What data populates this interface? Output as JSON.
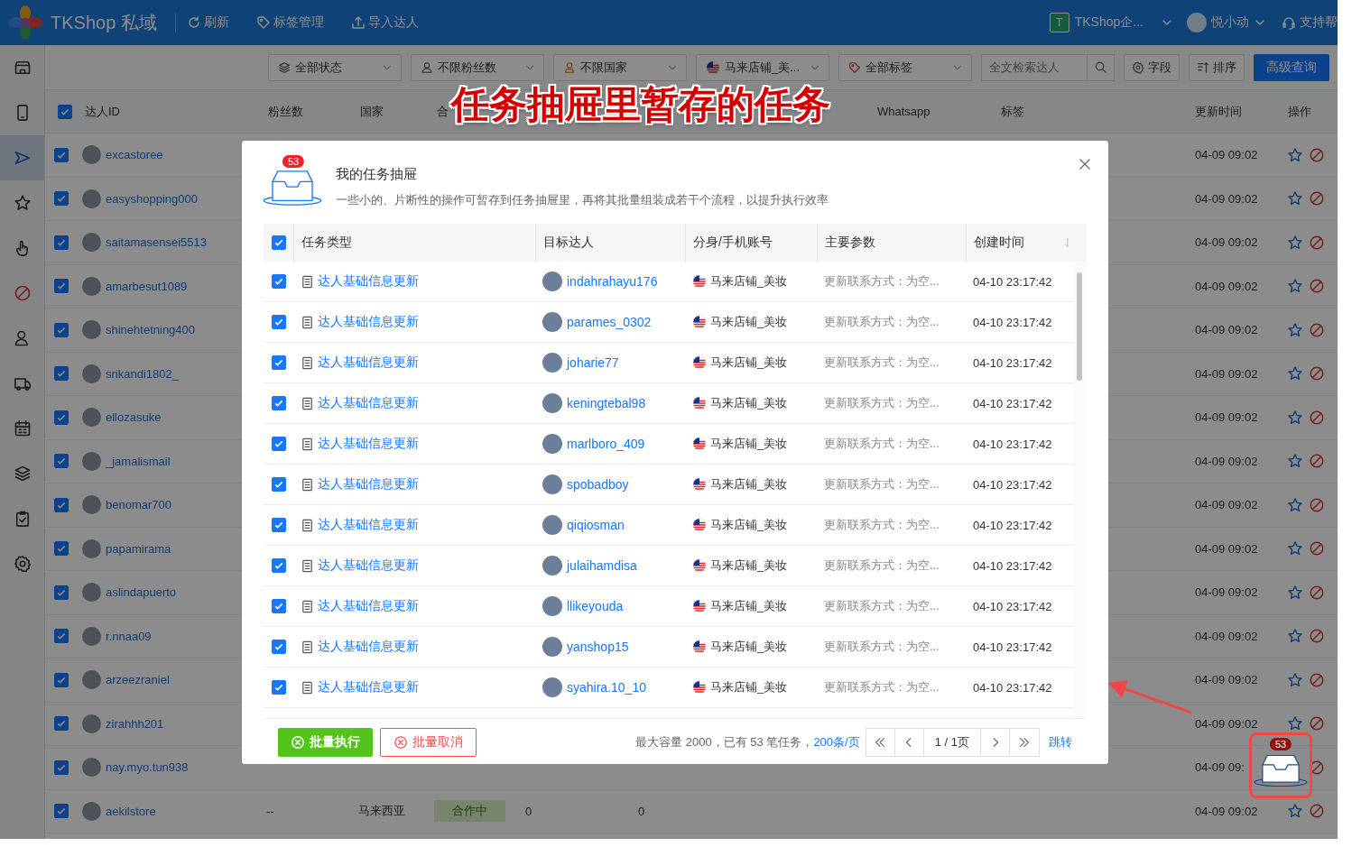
{
  "top_bar": {
    "app_name": "TKShop 私域",
    "actions": [
      "刷新",
      "标签管理",
      "导入达人"
    ],
    "team_badge": "T",
    "team": "TKShop企...",
    "user": "悦小动",
    "help": "支持帮"
  },
  "sidebar": {
    "items": [
      {
        "selected": false
      },
      {
        "selected": false
      },
      {
        "selected": true
      },
      {
        "selected": false
      },
      {
        "selected": false
      },
      {
        "selected": false
      },
      {
        "selected": false
      },
      {
        "selected": false
      },
      {
        "selected": false
      },
      {
        "selected": false
      },
      {
        "selected": false
      },
      {
        "selected": false
      }
    ]
  },
  "filters": [
    "全部状态",
    "不限粉丝数",
    "不限国家",
    "马来店铺_美...",
    "全部标签"
  ],
  "search": {
    "placeholder": "全文检索达人"
  },
  "tool_buttons": [
    "字段",
    "排序"
  ],
  "advanced_button": "高级查询",
  "table": {
    "all_checked": true,
    "columns": [
      "达人ID",
      "粉丝数",
      "国家",
      "合",
      "Whatsapp",
      "标签",
      "更新时间",
      "操作"
    ],
    "rows": [
      {
        "checked": true,
        "id": "excastoree",
        "updated": "04-09 09:02"
      },
      {
        "checked": true,
        "id": "easyshopping000",
        "updated": "04-09 09:02"
      },
      {
        "checked": true,
        "id": "saitamasensei5513",
        "updated": "04-09 09:02"
      },
      {
        "checked": true,
        "id": "amarbesut1089",
        "updated": "04-09 09:02"
      },
      {
        "checked": true,
        "id": "shinehtetning400",
        "updated": "04-09 09:02"
      },
      {
        "checked": true,
        "id": "srikandi1802_",
        "updated": "04-09 09:02"
      },
      {
        "checked": true,
        "id": "ellozasuke",
        "updated": "04-09 09:02"
      },
      {
        "checked": true,
        "id": "_jamalismail",
        "updated": "04-09 09:02"
      },
      {
        "checked": true,
        "id": "benomar700",
        "updated": "04-09 09:02"
      },
      {
        "checked": true,
        "id": "papamirama",
        "updated": "04-09 09:02"
      },
      {
        "checked": true,
        "id": "aslindapuerto",
        "updated": "04-09 09:02"
      },
      {
        "checked": true,
        "id": "r.nnaa09",
        "updated": "04-09 09:02"
      },
      {
        "checked": true,
        "id": "arzeezraniel",
        "updated": "04-09 09:02"
      },
      {
        "checked": true,
        "id": "zirahhh201",
        "updated": "04-09 09:02"
      },
      {
        "checked": true,
        "id": "nay.myo.tun938",
        "updated": "04-09 09:"
      },
      {
        "checked": true,
        "id": "aekilstore",
        "fans": "--",
        "country": "马来西亚",
        "status": "合作中",
        "column_5": "0",
        "column_6": "0",
        "updated": "04-09 09:02"
      }
    ]
  },
  "drawer": {
    "badge": "53",
    "title": "我的任务抽屉",
    "description": "一些小的、片断性的操作可暂存到任务抽屉里，再将其批量组装成若干个流程，以提升执行效率",
    "all_checked": true,
    "columns": [
      "任务类型",
      "目标达人",
      "分身/手机账号",
      "主要参数",
      "创建时间"
    ],
    "rows": [
      {
        "checked": true,
        "type": "达人基础信息更新",
        "target": "indahrahayu176",
        "account": "马来店铺_美妆",
        "params": "更新联系方式：为空...",
        "created": "04-10 23:17:42"
      },
      {
        "checked": true,
        "type": "达人基础信息更新",
        "target": "parames_0302",
        "account": "马来店铺_美妆",
        "params": "更新联系方式：为空...",
        "created": "04-10 23:17:42"
      },
      {
        "checked": true,
        "type": "达人基础信息更新",
        "target": "joharie77",
        "account": "马来店铺_美妆",
        "params": "更新联系方式：为空...",
        "created": "04-10 23:17:42"
      },
      {
        "checked": true,
        "type": "达人基础信息更新",
        "target": "keningtebal98",
        "account": "马来店铺_美妆",
        "params": "更新联系方式：为空...",
        "created": "04-10 23:17:42"
      },
      {
        "checked": true,
        "type": "达人基础信息更新",
        "target": "marlboro_409",
        "account": "马来店铺_美妆",
        "params": "更新联系方式：为空...",
        "created": "04-10 23:17:42"
      },
      {
        "checked": true,
        "type": "达人基础信息更新",
        "target": "spobadboy",
        "account": "马来店铺_美妆",
        "params": "更新联系方式：为空...",
        "created": "04-10 23:17:42"
      },
      {
        "checked": true,
        "type": "达人基础信息更新",
        "target": "qiqiosman",
        "account": "马来店铺_美妆",
        "params": "更新联系方式：为空...",
        "created": "04-10 23:17:42"
      },
      {
        "checked": true,
        "type": "达人基础信息更新",
        "target": "julaihamdisa",
        "account": "马来店铺_美妆",
        "params": "更新联系方式：为空...",
        "created": "04-10 23:17:42"
      },
      {
        "checked": true,
        "type": "达人基础信息更新",
        "target": "llikeyouda",
        "account": "马来店铺_美妆",
        "params": "更新联系方式：为空...",
        "created": "04-10 23:17:42"
      },
      {
        "checked": true,
        "type": "达人基础信息更新",
        "target": "yanshop15",
        "account": "马来店铺_美妆",
        "params": "更新联系方式：为空...",
        "created": "04-10 23:17:42"
      },
      {
        "checked": true,
        "type": "达人基础信息更新",
        "target": "syahira.10_10",
        "account": "马来店铺_美妆",
        "params": "更新联系方式：为空...",
        "created": "04-10 23:17:42"
      }
    ],
    "footer": {
      "execute": "批量执行",
      "cancel": "批量取消",
      "summary": "最大容量 2000，已有 53 笔任务，",
      "page_size": "200条/页",
      "page": "1 / 1页",
      "jump": "跳转"
    }
  },
  "drawer_button": {
    "badge": "53"
  },
  "annotation": {
    "title": "任务抽屉里暂存的任务"
  }
}
